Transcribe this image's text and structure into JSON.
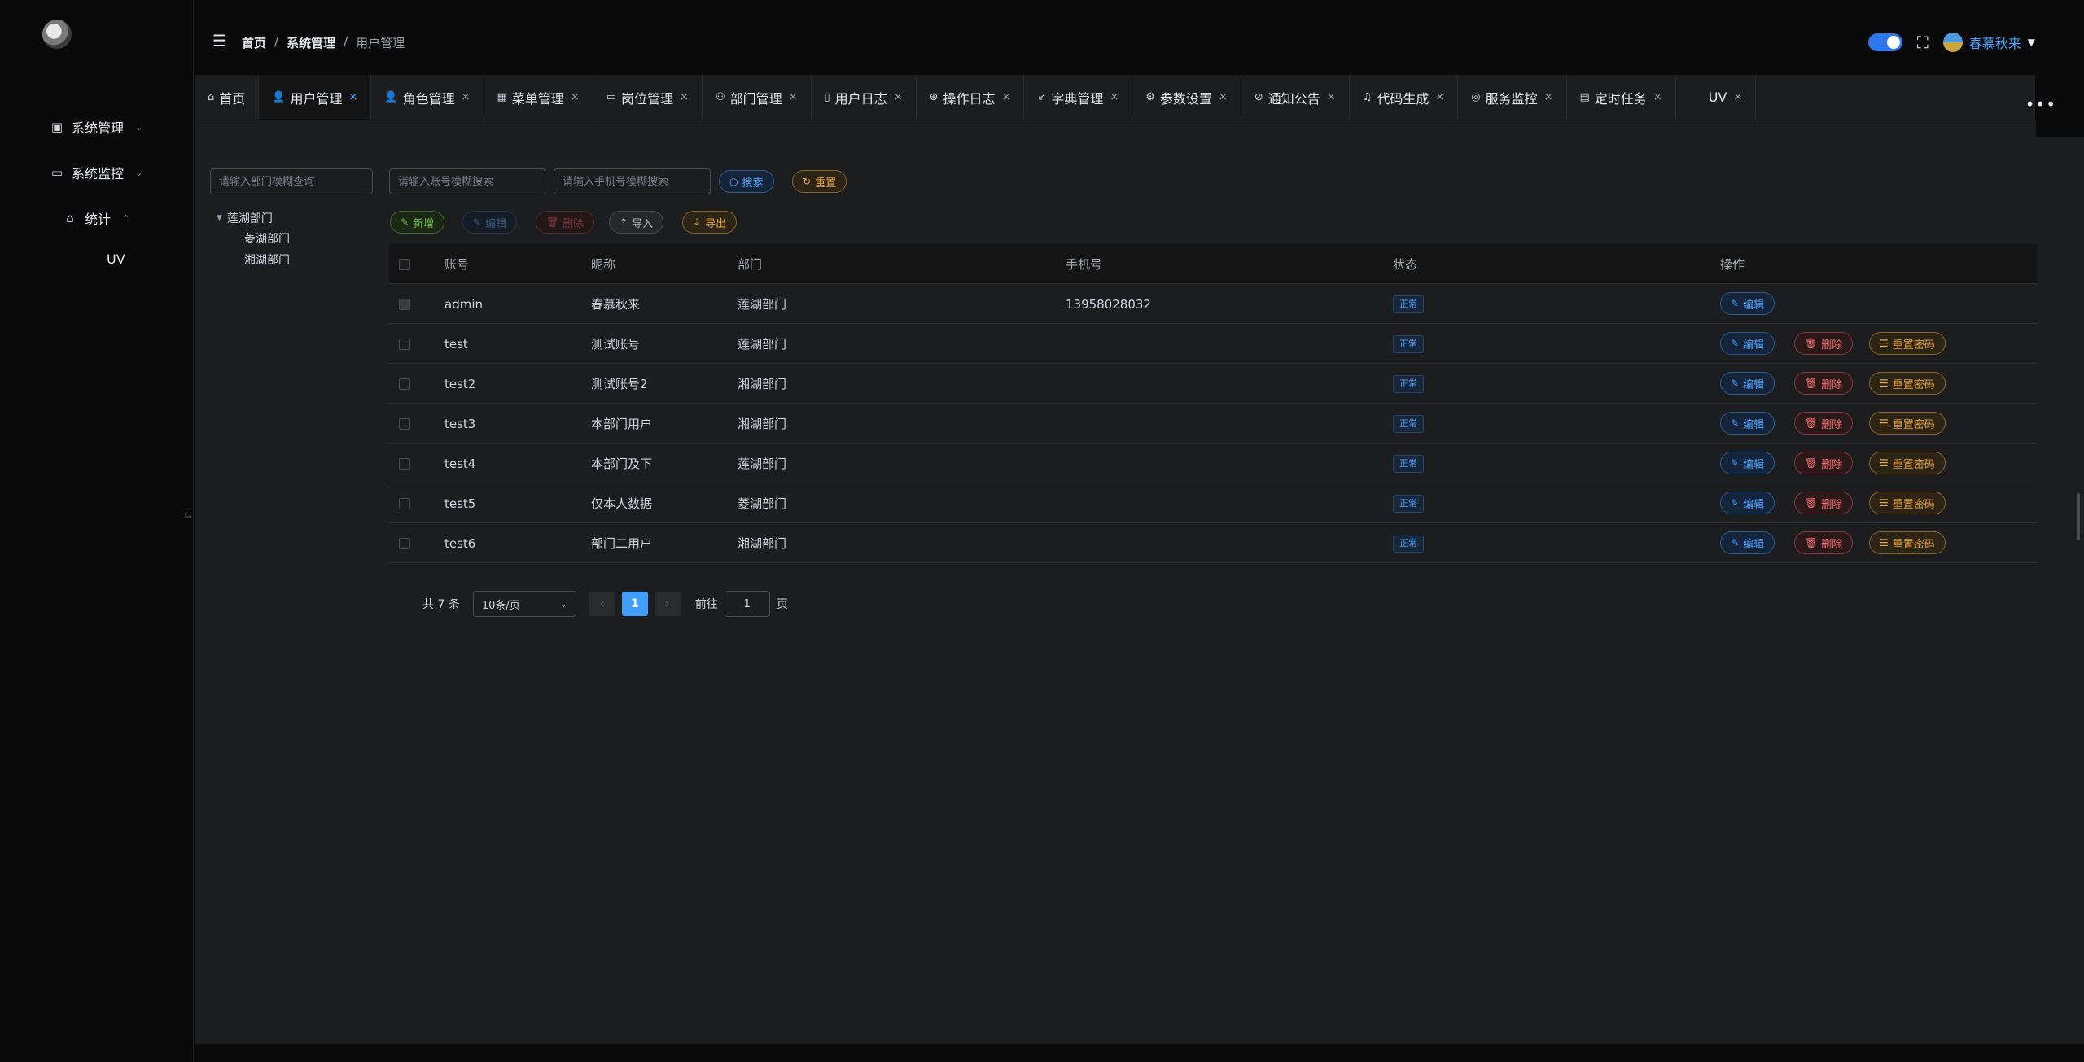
{
  "sidebar": {
    "items": [
      {
        "label": "系统管理",
        "icon": "system-icon",
        "caret": "⌄"
      },
      {
        "label": "系统监控",
        "icon": "monitor-icon",
        "caret": "⌄"
      },
      {
        "label": "统计",
        "icon": "home-icon",
        "caret": "⌃"
      }
    ],
    "submenu_item": "UV"
  },
  "header": {
    "breadcrumb": [
      "首页",
      "系统管理",
      "用户管理"
    ],
    "user_name": "春慕秋来"
  },
  "tabs": [
    {
      "label": "首页",
      "icon": "⌂"
    },
    {
      "label": "用户管理",
      "icon": "👤",
      "active": true
    },
    {
      "label": "角色管理",
      "icon": "👤"
    },
    {
      "label": "菜单管理",
      "icon": "▦"
    },
    {
      "label": "岗位管理",
      "icon": "▭"
    },
    {
      "label": "部门管理",
      "icon": "⚇"
    },
    {
      "label": "用户日志",
      "icon": "▯"
    },
    {
      "label": "操作日志",
      "icon": "⊕"
    },
    {
      "label": "字典管理",
      "icon": "↙"
    },
    {
      "label": "参数设置",
      "icon": "⚙"
    },
    {
      "label": "通知公告",
      "icon": "⊘"
    },
    {
      "label": "代码生成",
      "icon": "♫"
    },
    {
      "label": "服务监控",
      "icon": "◎"
    },
    {
      "label": "定时任务",
      "icon": "▤"
    },
    {
      "label": "UV",
      "icon": ""
    }
  ],
  "filters": {
    "dept_placeholder": "请输入部门模糊查询",
    "account_placeholder": "请输入账号模糊搜索",
    "phone_placeholder": "请输入手机号模糊搜索",
    "search_label": "搜索",
    "reset_label": "重置"
  },
  "toolbar": {
    "add_label": "新增",
    "edit_label": "编辑",
    "delete_label": "删除",
    "import_label": "导入",
    "export_label": "导出"
  },
  "tree": {
    "root": "莲湖部门",
    "children": [
      "菱湖部门",
      "湘湖部门"
    ]
  },
  "table": {
    "headers": [
      "账号",
      "昵称",
      "部门",
      "手机号",
      "状态",
      "操作"
    ],
    "rows": [
      {
        "account": "admin",
        "nickname": "春慕秋来",
        "dept": "莲湖部门",
        "phone": "13958028032",
        "status": "正常",
        "admin": true
      },
      {
        "account": "test",
        "nickname": "测试账号",
        "dept": "莲湖部门",
        "phone": "",
        "status": "正常"
      },
      {
        "account": "test2",
        "nickname": "测试账号2",
        "dept": "湘湖部门",
        "phone": "",
        "status": "正常"
      },
      {
        "account": "test3",
        "nickname": "本部门用户",
        "dept": "湘湖部门",
        "phone": "",
        "status": "正常"
      },
      {
        "account": "test4",
        "nickname": "本部门及下",
        "dept": "莲湖部门",
        "phone": "",
        "status": "正常"
      },
      {
        "account": "test5",
        "nickname": "仅本人数据",
        "dept": "菱湖部门",
        "phone": "",
        "status": "正常"
      },
      {
        "account": "test6",
        "nickname": "部门二用户",
        "dept": "湘湖部门",
        "phone": "",
        "status": "正常"
      }
    ],
    "edit_label": "编辑",
    "delete_label": "删除",
    "reset_pwd_label": "重置密码"
  },
  "pagination": {
    "total": "共 7 条",
    "page_size": "10条/页",
    "current_page": "1",
    "goto_label": "前往",
    "goto_value": "1",
    "page_unit": "页"
  },
  "colors": {
    "accent": "#409eff",
    "danger": "#f56c6c",
    "warning": "#e6a23c",
    "success": "#67c23a"
  }
}
